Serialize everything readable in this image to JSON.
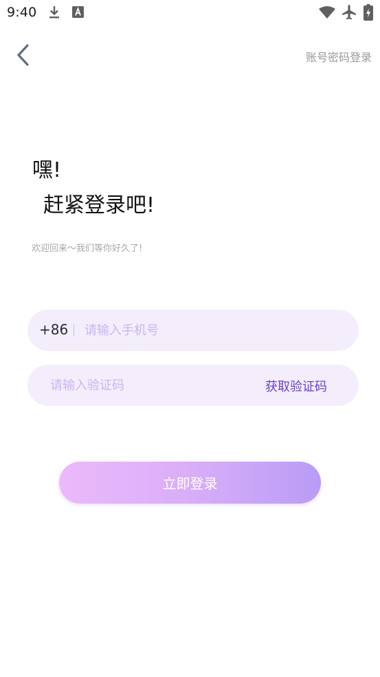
{
  "status_bar": {
    "time": "9:40",
    "icons": [
      "download-icon",
      "a-notification-icon",
      "wifi-icon",
      "airplane-icon",
      "battery-icon"
    ]
  },
  "nav": {
    "back_icon": "chevron-left-icon",
    "password_login_link": "账号密码登录"
  },
  "greeting": {
    "line1": "嘿!",
    "line2": "赶紧登录吧!",
    "subtitle": "欢迎回来～我们等你好久了!"
  },
  "form": {
    "country_code": "+86",
    "phone_placeholder": "请输入手机号",
    "phone_value": "",
    "code_placeholder": "请输入验证码",
    "code_value": "",
    "get_code_label": "获取验证码"
  },
  "login_button_label": "立即登录",
  "colors": {
    "accent": "#6a3fd0",
    "field_bg": "#f4eefc",
    "placeholder": "#cbb4f2",
    "button_gradient_start": "#ebb9fb",
    "button_gradient_end": "#b99cf6"
  }
}
